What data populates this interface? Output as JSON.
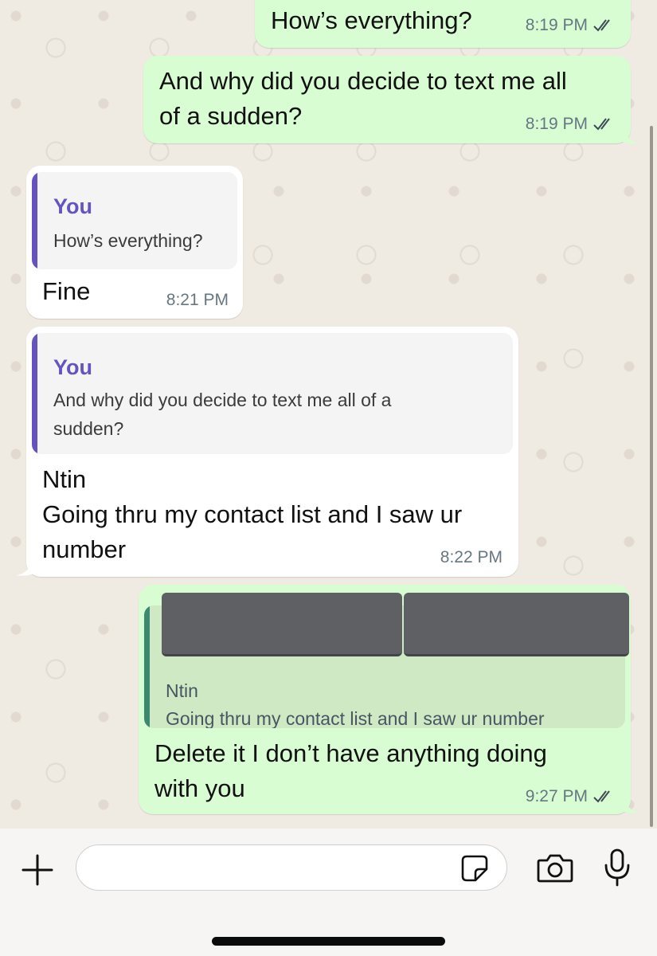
{
  "messages": [
    {
      "text": "How’s everything?",
      "time": "8:19 PM"
    },
    {
      "text_line1": "And why did you decide to text me all",
      "text_line2": "of a sudden?",
      "time": "8:19 PM"
    },
    {
      "quote_name": "You",
      "quote_text": "How’s everything?",
      "text": "Fine",
      "time": "8:21 PM"
    },
    {
      "quote_name": "You",
      "quote_line1": "And why did you decide to text me all of a",
      "quote_line2": "sudden?",
      "line1": "Ntin",
      "line2": "Going thru my contact list and I saw ur",
      "line3": "number",
      "time": "8:22 PM"
    },
    {
      "quote_name": "Ntin",
      "quote_text": "Going thru my contact list and I saw ur number",
      "line1": "Delete it I don’t have anything doing",
      "line2": "with you",
      "time": "9:27 PM"
    }
  ],
  "icons": {
    "add": "plus-icon",
    "sticker": "sticker-icon",
    "camera": "camera-icon",
    "mic": "microphone-icon",
    "ticks": "double-check-icon"
  },
  "colors": {
    "outgoing_bubble": "#d9fdd3",
    "incoming_bubble": "#ffffff",
    "quote_accent_in": "#6554c0",
    "quote_accent_out": "#3b8a70",
    "background": "#efeae2"
  }
}
